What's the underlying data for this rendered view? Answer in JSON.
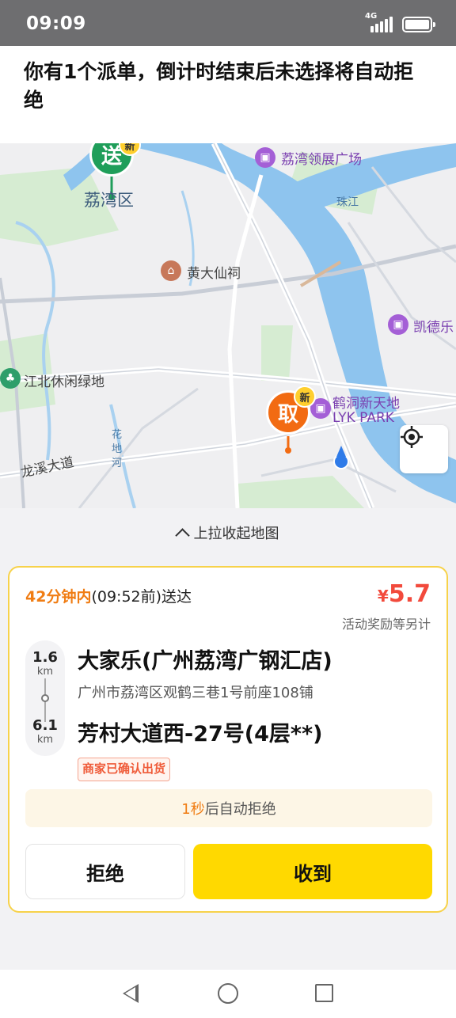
{
  "status_bar": {
    "time": "09:09",
    "network": "4G",
    "colors": {
      "background": "#6e6e70"
    }
  },
  "notice": {
    "text": "你有1个派单，倒计时结束后未选择将自动拒绝"
  },
  "map": {
    "labels": {
      "liwan_mall": "荔湾领展广场",
      "liwan_district": "荔湾区",
      "pearl_river": "珠江",
      "huangdaxian": "黄大仙祠",
      "kaide": "凯德乐",
      "jiangbei_park": "江北休闲绿地",
      "hedong": "鹤洞新天地",
      "lyk_park": "LYK PARK",
      "huadi_river": "花地河",
      "longxi_road": "龙溪大道"
    },
    "pins": {
      "delivery": {
        "label": "送",
        "badge": "新",
        "color": "#1f9e5a"
      },
      "pickup": {
        "label": "取",
        "badge": "新",
        "color": "#f26b12"
      }
    },
    "icons": {
      "locate": "locate-icon"
    }
  },
  "collapse_hint": "上拉收起地图",
  "order": {
    "deadline_highlight": "42分钟内",
    "deadline_rest": "(09:52前)送达",
    "price_symbol": "¥",
    "price_value": "5.7",
    "bonus_note": "活动奖励等另计",
    "pickup_distance": "1.6",
    "pickup_unit": "km",
    "delivery_distance": "6.1",
    "delivery_unit": "km",
    "shop_name": "大家乐(广州荔湾广钢汇店)",
    "shop_address": "广州市荔湾区观鹤三巷1号前座108铺",
    "destination": "芳村大道西-27号(4层**)",
    "merchant_tag": "商家已确认出货",
    "auto_reject_seconds": "1秒",
    "auto_reject_text": "后自动拒绝",
    "reject_label": "拒绝",
    "accept_label": "收到",
    "colors": {
      "accent": "#ffd900",
      "price": "#f24a3c",
      "highlight": "#f07d14",
      "card_border": "#f7d24a"
    }
  },
  "navbar": {
    "back": "back-icon",
    "home": "home-icon",
    "recents": "recents-icon"
  }
}
